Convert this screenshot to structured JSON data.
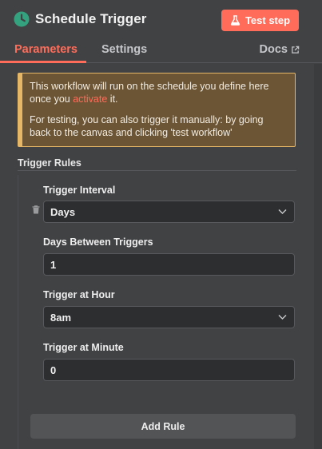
{
  "header": {
    "title": "Schedule Trigger",
    "title_icon": "clock-icon",
    "test_button_label": "Test step",
    "test_button_icon": "flask-icon"
  },
  "tabs": {
    "items": [
      {
        "label": "Parameters",
        "active": true
      },
      {
        "label": "Settings",
        "active": false
      }
    ],
    "docs_label": "Docs",
    "docs_icon": "external-link-icon"
  },
  "notice": {
    "line1_prefix": "This workflow will run on the schedule you define here once you ",
    "line1_link": "activate",
    "line1_suffix": " it.",
    "line2": "For testing, you can also trigger it manually: by going back to the canvas and clicking 'test workflow'"
  },
  "trigger_rules": {
    "title": "Trigger Rules",
    "fields": {
      "interval": {
        "label": "Trigger Interval",
        "value": "Days"
      },
      "days_between": {
        "label": "Days Between Triggers",
        "value": "1"
      },
      "hour": {
        "label": "Trigger at Hour",
        "value": "8am"
      },
      "minute": {
        "label": "Trigger at Minute",
        "value": "0"
      }
    },
    "add_rule_label": "Add Rule"
  },
  "colors": {
    "accent": "#ff6d5a",
    "panel_bg": "#414244",
    "notice_bg": "#6b5535",
    "notice_border": "#e6b766",
    "clock_green": "#35a27f"
  }
}
